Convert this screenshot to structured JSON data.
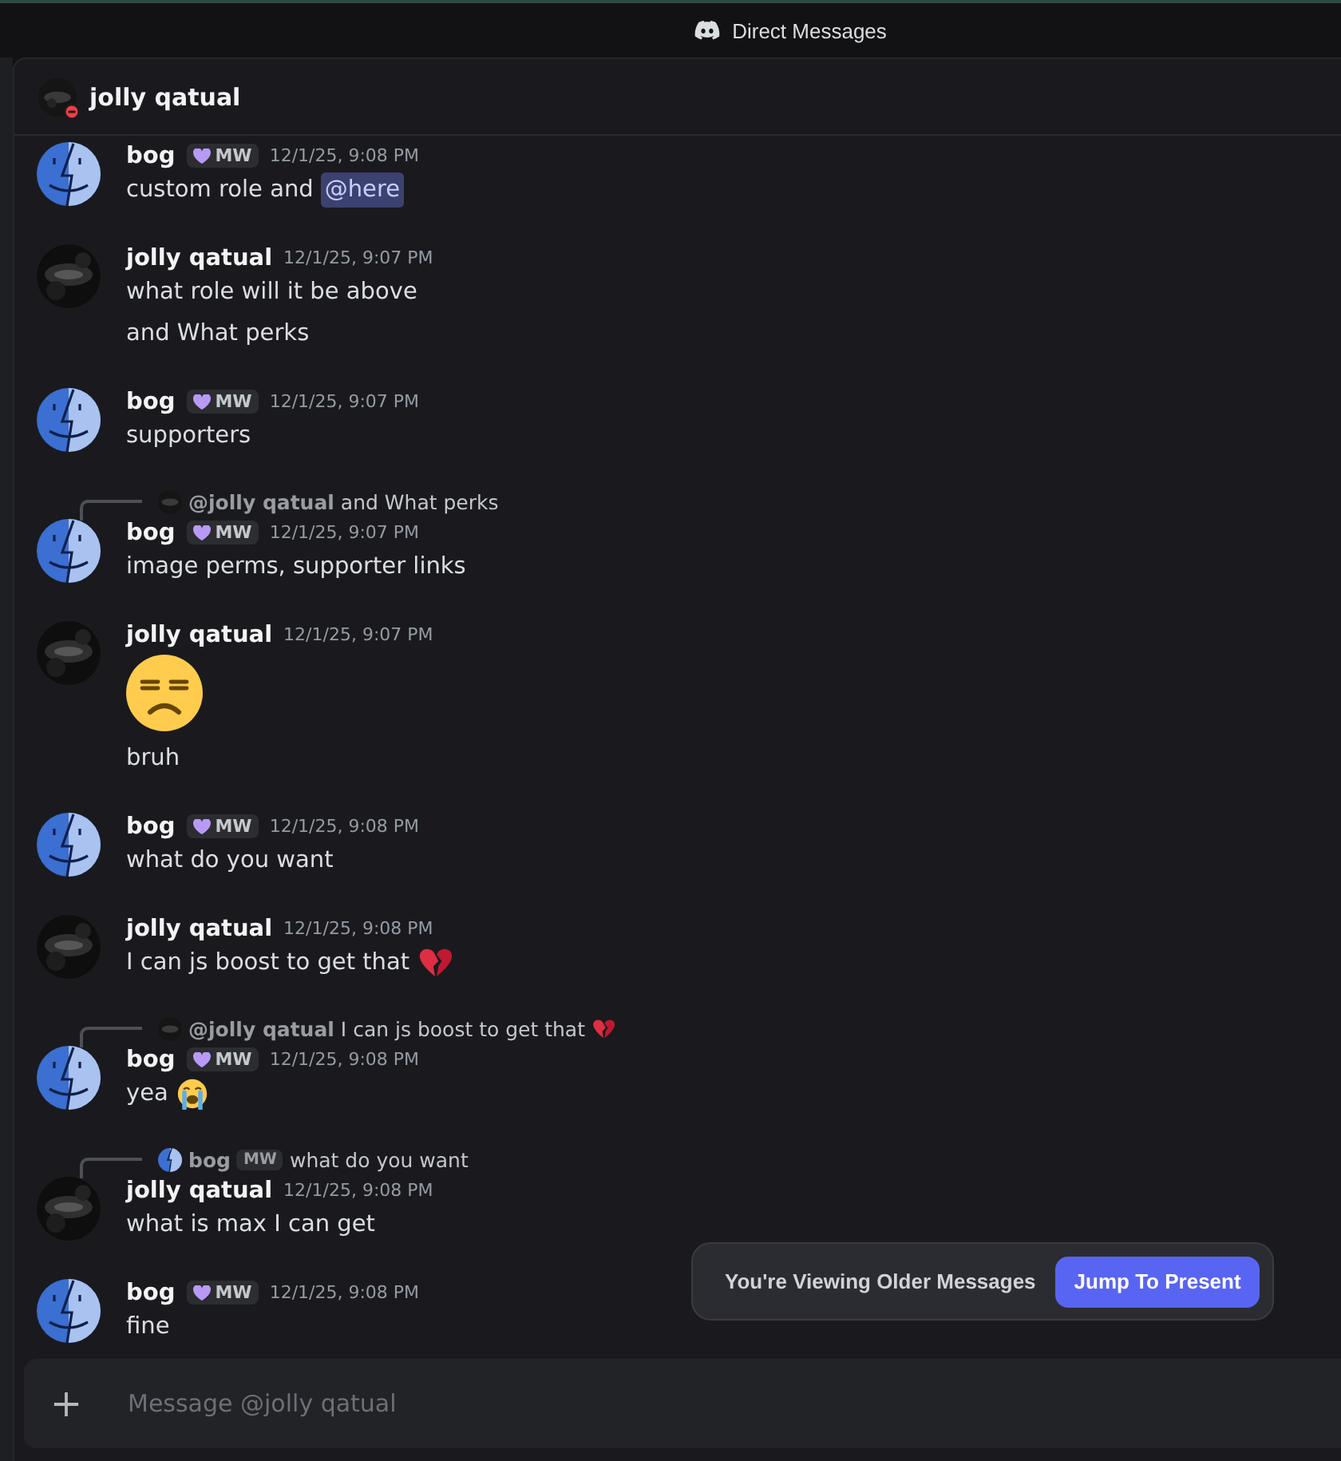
{
  "title_bar": {
    "title": "Direct Messages"
  },
  "channel_header": {
    "name": "jolly qatual",
    "avatar": {
      "kind": "dark_photo"
    },
    "do_not_disturb": true
  },
  "messages": [
    {
      "author": "bog",
      "avatar": {
        "kind": "split_face"
      },
      "badge": "MW",
      "time": "12/1/25, 9:08 PM",
      "lines": [
        {
          "kind": "mention_text",
          "text": "custom role and",
          "mention": "@here"
        }
      ]
    },
    {
      "author": "jolly qatual",
      "avatar": {
        "kind": "dark_photo"
      },
      "time": "12/1/25, 9:07 PM",
      "lines": [
        {
          "kind": "text",
          "text": "what role will it be above"
        },
        {
          "kind": "text",
          "text": "and What perks"
        }
      ]
    },
    {
      "author": "bog",
      "avatar": {
        "kind": "split_face"
      },
      "badge": "MW",
      "time": "12/1/25, 9:07 PM",
      "lines": [
        {
          "kind": "text",
          "text": "supporters"
        }
      ]
    },
    {
      "reply": {
        "avatar": {
          "kind": "dark_photo"
        },
        "author": "@jolly qatual",
        "text": "and What perks"
      },
      "author": "bog",
      "avatar": {
        "kind": "split_face"
      },
      "badge": "MW",
      "time": "12/1/25, 9:07 PM",
      "lines": [
        {
          "kind": "text",
          "text": "image perms, supporter links"
        }
      ]
    },
    {
      "author": "jolly qatual",
      "avatar": {
        "kind": "dark_photo"
      },
      "time": "12/1/25, 9:07 PM",
      "lines": [
        {
          "kind": "emoji_unamused"
        },
        {
          "kind": "text",
          "text": "bruh"
        }
      ]
    },
    {
      "author": "bog",
      "avatar": {
        "kind": "split_face"
      },
      "badge": "MW",
      "time": "12/1/25, 9:08 PM",
      "lines": [
        {
          "kind": "text",
          "text": "what do you want"
        }
      ]
    },
    {
      "author": "jolly qatual",
      "avatar": {
        "kind": "dark_photo"
      },
      "time": "12/1/25, 9:08 PM",
      "lines": [
        {
          "kind": "text",
          "text": "I can js boost to get that",
          "emoji": {
            "kind": "broken_heart"
          }
        }
      ]
    },
    {
      "reply": {
        "avatar": {
          "kind": "dark_photo"
        },
        "author": "@jolly qatual",
        "text": "I can js boost to get that",
        "emoji": {
          "kind": "broken_heart"
        }
      },
      "author": "bog",
      "avatar": {
        "kind": "split_face"
      },
      "badge": "MW",
      "time": "12/1/25, 9:08 PM",
      "lines": [
        {
          "kind": "text",
          "text": "yea",
          "emoji": {
            "kind": "crying"
          }
        }
      ]
    },
    {
      "reply": {
        "avatar": {
          "kind": "split_face"
        },
        "author": "bog",
        "badge": "MW",
        "text": "what do you want"
      },
      "author": "jolly qatual",
      "avatar": {
        "kind": "dark_photo"
      },
      "time": "12/1/25, 9:08 PM",
      "lines": [
        {
          "kind": "text",
          "text": "what is max I can get"
        }
      ]
    },
    {
      "author": "bog",
      "avatar": {
        "kind": "split_face"
      },
      "badge": "MW",
      "time": "12/1/25, 9:08 PM",
      "lines": [
        {
          "kind": "text",
          "text": "fine"
        }
      ]
    }
  ],
  "older_banner": {
    "text": "You're Viewing Older Messages",
    "button": "Jump To Present"
  },
  "composer": {
    "placeholder": "Message @jolly qatual"
  }
}
